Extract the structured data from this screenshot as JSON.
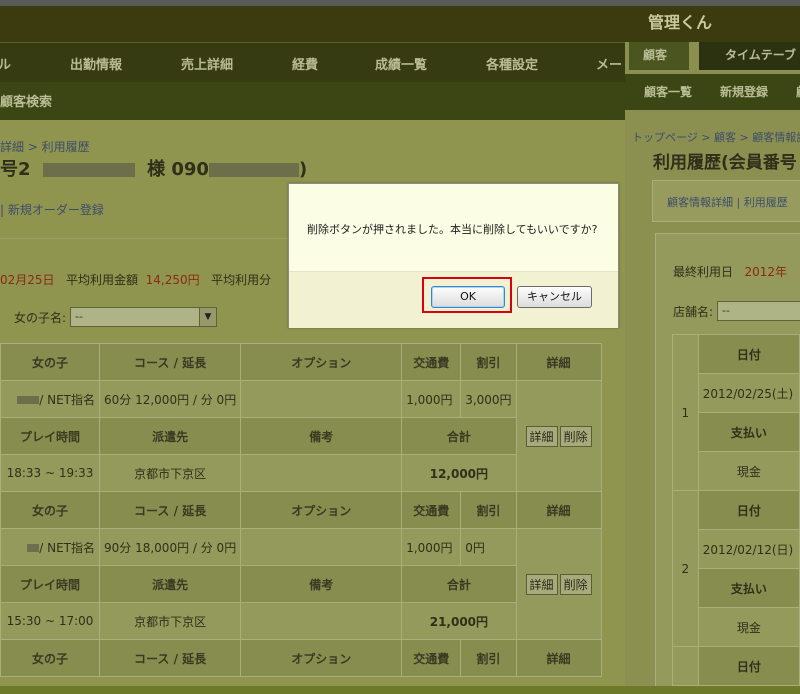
{
  "app": {
    "title": "管理くん"
  },
  "nav": {
    "items": [
      "ル",
      "出勤情報",
      "売上詳細",
      "経費",
      "成績一覧",
      "各種設定",
      "メー"
    ],
    "sub": "顧客検索"
  },
  "breadcrumb": "詳細 > 利用履歴",
  "title": {
    "prefix": "号2",
    "mid": "様 090",
    "suffix": ")"
  },
  "sublink": "| 新規オーダー登録",
  "stats": {
    "last": "02月25日",
    "avg_label": "平均利用金額",
    "avg_value": "14,250円",
    "avg_freq": "平均利用分"
  },
  "filter": {
    "label": "女の子名:",
    "value": "--"
  },
  "table": {
    "header1": [
      "女の子",
      "コース / 延長",
      "オプション",
      "交通費",
      "割引",
      "詳細"
    ],
    "header2": [
      "プレイ時間",
      "派遣先",
      "備考",
      "合計"
    ],
    "records": [
      {
        "girl": "/ NET指名",
        "course": "60分 12,000円 / 分 0円",
        "transport": "1,000円",
        "discount": "3,000円",
        "time": "18:33 ~ 19:33",
        "dest": "京都市下京区",
        "total": "12,000円"
      },
      {
        "girl": "/ NET指名",
        "course": "90分 18,000円 / 分 0円",
        "transport": "1,000円",
        "discount": "0円",
        "time": "15:30 ~ 17:00",
        "dest": "京都市下京区",
        "total": "21,000円"
      }
    ],
    "detail_label": "詳細",
    "delete_label": "削除"
  },
  "right": {
    "tabs": [
      "顧客",
      "タイムテーブ"
    ],
    "nav2": [
      "顧客一覧",
      "新規登録",
      "顧"
    ],
    "breadcrumb": "トップページ > 顧客 > 顧客情報詳",
    "title": "利用履歴(会員番号",
    "box": "顧客情報詳細 | 利用履歴",
    "last_label": "最終利用日",
    "last_value": "2012年",
    "shop_label": "店舗名:",
    "shop_value": "--",
    "rows": [
      {
        "n": "1",
        "date_h": "日付",
        "date": "2012/02/25(土)",
        "pay_h": "支払い",
        "pay": "現金"
      },
      {
        "n": "2",
        "date_h": "日付",
        "date": "2012/02/12(日)",
        "pay_h": "支払い",
        "pay": "現金"
      }
    ],
    "last_date_h": "日付"
  },
  "dialog": {
    "message": "削除ボタンが押されました。本当に削除してもいいですか?",
    "ok": "OK",
    "cancel": "キャンセル"
  }
}
